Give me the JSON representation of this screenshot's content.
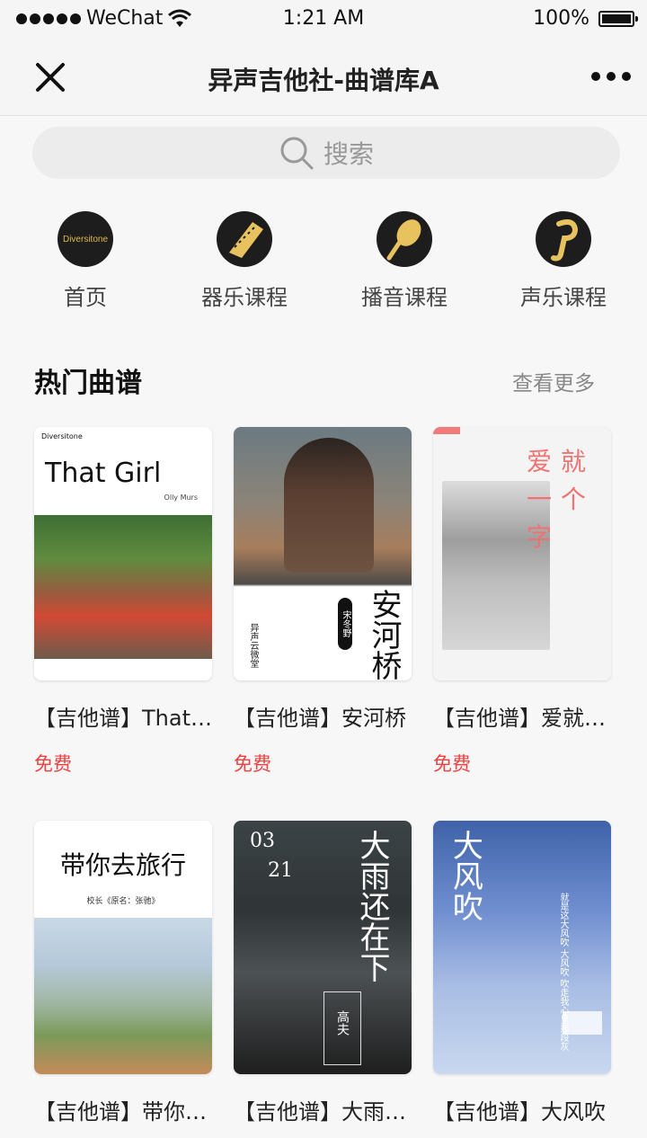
{
  "status_bar": {
    "carrier": "WeChat",
    "time": "1:21 AM",
    "battery": "100%"
  },
  "nav": {
    "title": "异声吉他社-曲谱库A"
  },
  "search": {
    "placeholder": "搜索"
  },
  "categories": [
    {
      "label": "首页",
      "icon": "diversitone-logo-icon",
      "logo_text": "Diversitone"
    },
    {
      "label": "器乐课程",
      "icon": "guitar-neck-icon"
    },
    {
      "label": "播音课程",
      "icon": "microphone-icon"
    },
    {
      "label": "声乐课程",
      "icon": "music-note-icon"
    }
  ],
  "section": {
    "title": "热门曲谱",
    "more": "查看更多"
  },
  "cards": [
    {
      "name": "【吉他谱】That Girl",
      "price": "免费",
      "cover": {
        "title": "That Girl",
        "artist": "Olly Murs",
        "brand": "Diversitone"
      }
    },
    {
      "name": "【吉他谱】安河桥",
      "price": "免费",
      "cover": {
        "title": "安河桥",
        "artist": "宋冬野",
        "side": "异声云微堂"
      }
    },
    {
      "name": "【吉他谱】爱就一个字",
      "price": "免费",
      "cover": {
        "line1": "爱",
        "line2": "就",
        "line3": "一",
        "line4": "个",
        "line5": "字"
      }
    },
    {
      "name": "【吉他谱】带你去旅行",
      "price": "",
      "cover": {
        "title": "带你去旅行",
        "sub": "校长《原名：张驰》"
      }
    },
    {
      "name": "【吉他谱】大雨还在下",
      "price": "",
      "cover": {
        "date_top": "03",
        "date_bottom": "21",
        "title": "大雨还在下",
        "artist": "高夫"
      }
    },
    {
      "name": "【吉他谱】大风吹",
      "price": "",
      "cover": {
        "title": "大风吹",
        "lines": "就是这大风吹 大风吹 吹走我心里那段灰"
      }
    }
  ]
}
